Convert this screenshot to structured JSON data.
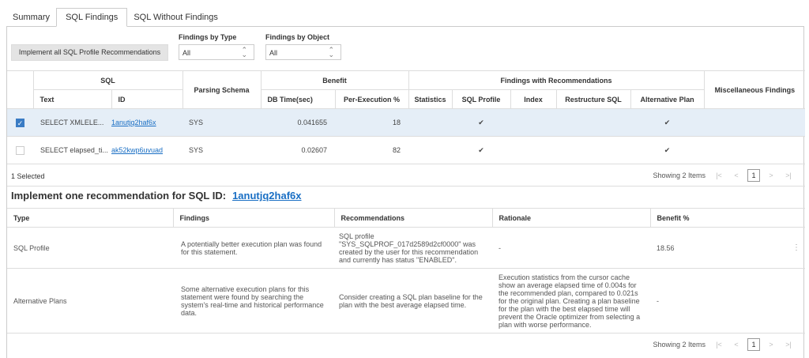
{
  "tabs": [
    "Summary",
    "SQL Findings",
    "SQL Without Findings"
  ],
  "toolbar": {
    "implement_all": "Implement all SQL Profile Recommendations",
    "type_label": "Findings by Type",
    "type_value": "All",
    "object_label": "Findings by Object",
    "object_value": "All"
  },
  "findings_table": {
    "groups": {
      "sql": "SQL",
      "parsing_schema": "Parsing Schema",
      "benefit": "Benefit",
      "findings_with_recs": "Findings with Recommendations",
      "misc": "Miscellaneous Findings"
    },
    "columns": {
      "text": "Text",
      "id": "ID",
      "db_time": "DB Time(sec)",
      "per_exec": "Per-Execution %",
      "statistics": "Statistics",
      "sql_profile": "SQL Profile",
      "index": "Index",
      "restructure": "Restructure SQL",
      "alt_plan": "Alternative Plan"
    },
    "rows": [
      {
        "selected": true,
        "text": "SELECT XMLELE...",
        "id": "1anutjq2haf6x",
        "schema": "SYS",
        "db_time": "0.041655",
        "per_exec": "18",
        "statistics": "",
        "sql_profile": "✔",
        "index": "",
        "restructure": "",
        "alt_plan": "✔",
        "misc": ""
      },
      {
        "selected": false,
        "text": "SELECT elapsed_ti...",
        "id": "ak52kwp6uvuad",
        "schema": "SYS",
        "db_time": "0.02607",
        "per_exec": "82",
        "statistics": "",
        "sql_profile": "✔",
        "index": "",
        "restructure": "",
        "alt_plan": "✔",
        "misc": ""
      }
    ],
    "footer": {
      "selected": "1 Selected",
      "showing": "Showing 2 Items",
      "page": "1"
    }
  },
  "recommendation": {
    "title": "Implement one recommendation for SQL ID:",
    "sql_id": "1anutjq2haf6x",
    "columns": [
      "Type",
      "Findings",
      "Recommendations",
      "Rationale",
      "Benefit %"
    ],
    "rows": [
      {
        "type": "SQL Profile",
        "findings": "A potentially better execution plan was found for this statement.",
        "recommendations": "SQL profile \"SYS_SQLPROF_017d2589d2cf0000\" was created by the user for this recommendation and currently has status \"ENABLED\".",
        "rationale": "-",
        "benefit": "18.56"
      },
      {
        "type": "Alternative Plans",
        "findings": "Some alternative execution plans for this statement were found by searching the system's real-time and historical performance data.",
        "recommendations": "Consider creating a SQL plan baseline for the plan with the best average elapsed time.",
        "rationale": "Execution statistics from the cursor cache show an average elapsed time of 0.004s for the recommended plan, compared to 0.021s for the original plan. Creating a plan baseline for the plan with the best elapsed time will prevent the Oracle optimizer from selecting a plan with worse performance.",
        "benefit": "-"
      }
    ],
    "footer": {
      "showing": "Showing 2 Items",
      "page": "1"
    }
  }
}
